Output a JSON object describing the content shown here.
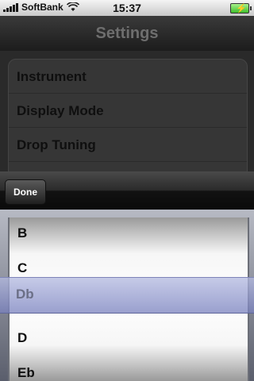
{
  "status_bar": {
    "carrier": "SoftBank",
    "time": "15:37",
    "signal_icon": "signal-bars-icon",
    "wifi_icon": "wifi-icon",
    "battery_icon": "battery-charging-icon",
    "battery_level": 1.0
  },
  "navbar": {
    "title": "Settings"
  },
  "settings": {
    "items": [
      {
        "label": "Instrument"
      },
      {
        "label": "Display Mode"
      },
      {
        "label": "Drop Tuning"
      }
    ]
  },
  "toolbar": {
    "done_label": "Done"
  },
  "picker": {
    "items": [
      "B",
      "C",
      "Db",
      "D",
      "Eb"
    ],
    "selected": "Db"
  },
  "colors": {
    "navbar_bg": "#1c1c1c",
    "selection_band": "#8f95c8",
    "battery_green": "#3fbf2c"
  }
}
